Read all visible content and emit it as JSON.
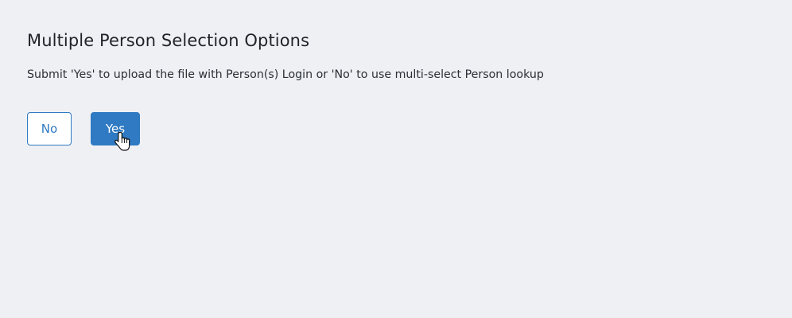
{
  "dialog": {
    "title": "Multiple Person Selection Options",
    "description": "Submit 'Yes' to upload the file with Person(s) Login or 'No' to use multi-select Person lookup"
  },
  "buttons": {
    "no_label": "No",
    "yes_label": "Yes"
  },
  "colors": {
    "background": "#eff0f4",
    "accent": "#2f7ac2"
  },
  "icons": {
    "cursor": "hand-pointer-icon"
  }
}
